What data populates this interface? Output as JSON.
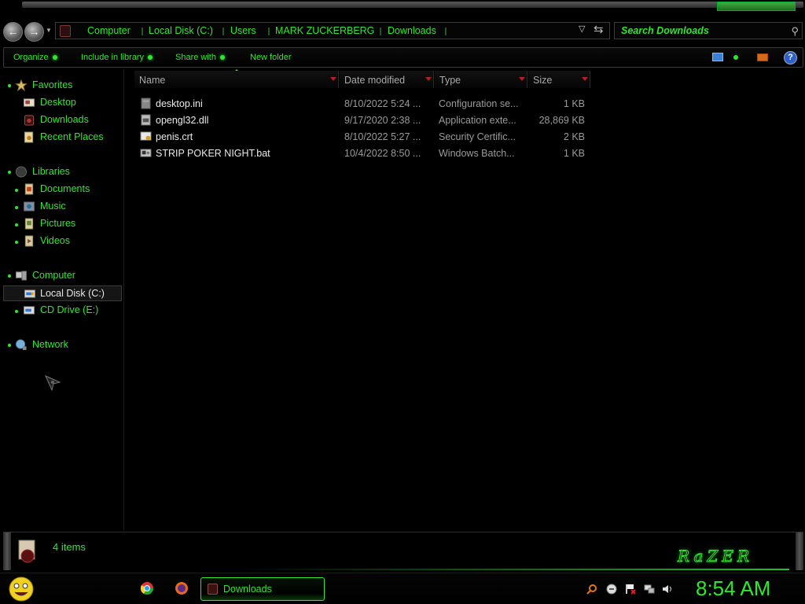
{
  "address": {
    "crumbs": [
      "Computer",
      "Local Disk (C:)",
      "Users",
      "MARK ZUCKERBERG",
      "Downloads"
    ],
    "search_placeholder": "Search Downloads"
  },
  "toolbar": {
    "organize": "Organize",
    "include_in_library": "Include in library",
    "share_with": "Share with",
    "new_folder": "New folder",
    "help_label": "?"
  },
  "nav": {
    "favorites": "Favorites",
    "favorites_items": [
      "Desktop",
      "Downloads",
      "Recent Places"
    ],
    "libraries": "Libraries",
    "library_items": [
      "Documents",
      "Music",
      "Pictures",
      "Videos"
    ],
    "computer": "Computer",
    "computer_items": [
      "Local Disk (C:)",
      "CD Drive (E:)"
    ],
    "network": "Network"
  },
  "columns": {
    "name": "Name",
    "date_modified": "Date modified",
    "type": "Type",
    "size": "Size"
  },
  "files": [
    {
      "name": "desktop.ini",
      "date": "8/10/2022 5:24 ...",
      "type": "Configuration se...",
      "size": "1 KB"
    },
    {
      "name": "opengl32.dll",
      "date": "9/17/2020 2:38 ...",
      "type": "Application exte...",
      "size": "28,869 KB"
    },
    {
      "name": "penis.crt",
      "date": "8/10/2022 5:27 ...",
      "type": "Security Certific...",
      "size": "2 KB"
    },
    {
      "name": "STRIP POKER NIGHT.bat",
      "date": "10/4/2022 8:50 ...",
      "type": "Windows Batch...",
      "size": "1 KB"
    }
  ],
  "details": {
    "item_count": "4 items",
    "brand": "RaZER"
  },
  "taskbar": {
    "active_window": "Downloads",
    "clock": "8:54 AM"
  },
  "colors": {
    "accent": "#2ee82e",
    "background": "#000000"
  }
}
